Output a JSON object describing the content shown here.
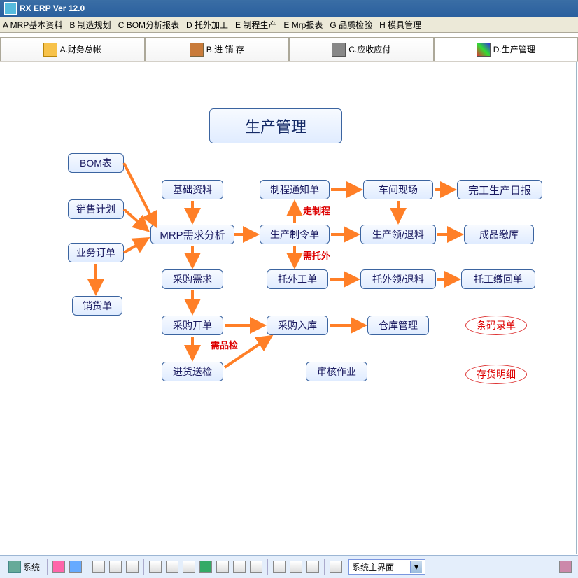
{
  "window": {
    "title": "RX ERP Ver 12.0"
  },
  "menu": {
    "items": [
      "A MRP基本资料",
      "B 制造规划",
      "C BOM分析报表",
      "D 托外加工",
      "E 制程生产",
      "E Mrp报表",
      "G 品质检验",
      "H 模具管理"
    ]
  },
  "tabs": {
    "items": [
      {
        "label": "A.财务总帐"
      },
      {
        "label": "B.进 销 存"
      },
      {
        "label": "C.应收应付"
      },
      {
        "label": "D.生产管理"
      }
    ],
    "active": 3
  },
  "diagram": {
    "title": "生产管理",
    "nodes": {
      "bom": "BOM表",
      "sales_plan": "销售计划",
      "biz_order": "业务订单",
      "sales_slip": "销货单",
      "base_data": "基础资料",
      "mrp": "MRP需求分析",
      "purchase_req": "采购需求",
      "purchase_open": "采购开单",
      "incoming_inspect": "进货送检",
      "route_notice": "制程通知单",
      "prod_order": "生产制令单",
      "outsource_order": "托外工单",
      "purchase_in": "采购入库",
      "review": "审核作业",
      "workshop": "车间现场",
      "prod_pick": "生产领/退料",
      "out_pick": "托外领/退料",
      "warehouse": "仓库管理",
      "finish_daily": "完工生产日报",
      "finish_store": "成品缴库",
      "out_return": "托工缴回单"
    },
    "labels": {
      "go_route": "走制程",
      "need_out": "需托外",
      "need_qc": "需品检"
    },
    "ovals": {
      "barcode": "条码录单",
      "stock_detail": "存货明细"
    }
  },
  "bottom": {
    "system": "系统",
    "combo": "系统主界面"
  }
}
